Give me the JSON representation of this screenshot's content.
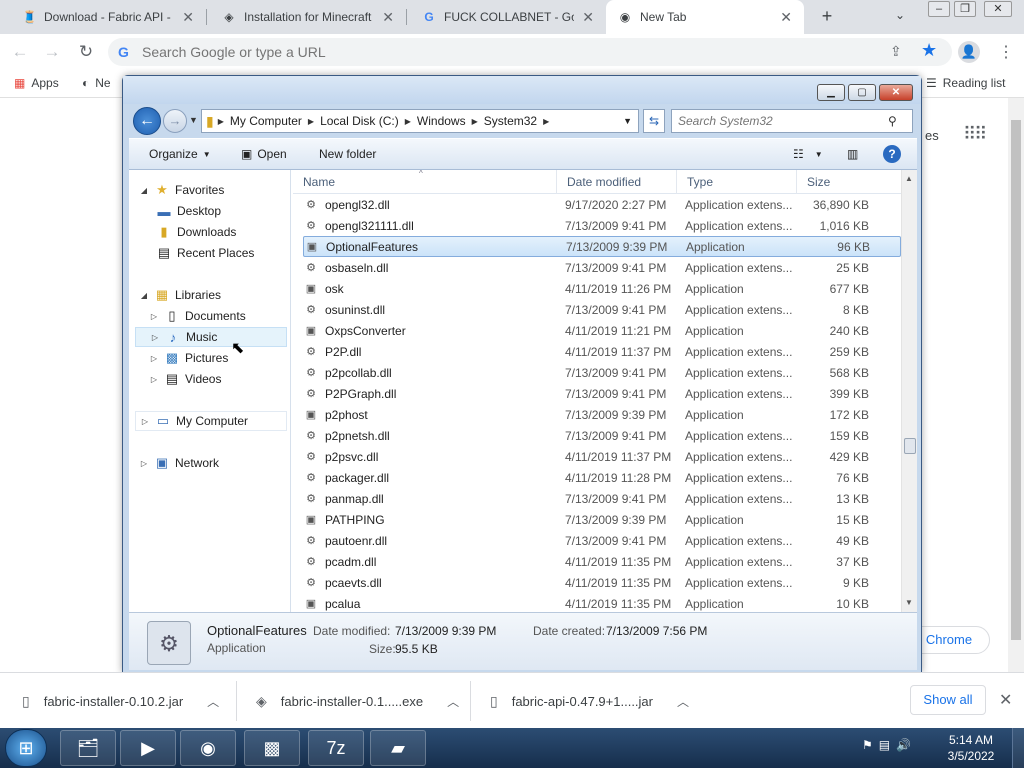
{
  "chrome": {
    "tabs": [
      {
        "title": "Download - Fabric API - M",
        "favicon": "fabric-icon",
        "active": false
      },
      {
        "title": "Installation for Minecraft",
        "favicon": "fabric-diamond-icon",
        "active": false
      },
      {
        "title": "FUCK COLLABNET - Goo",
        "favicon": "google-icon",
        "active": false
      },
      {
        "title": "New Tab",
        "favicon": "chrome-icon",
        "active": true
      }
    ],
    "new_tab_button": "+",
    "omnibox_placeholder": "Search Google or type a URL",
    "bookmarks": [
      {
        "label": "Apps",
        "icon": "apps-grid-icon"
      },
      {
        "label": "Ne",
        "icon": "globe-icon"
      }
    ],
    "reading_list": "Reading list",
    "ntp": {
      "partial_text": "es",
      "customize_label": "e Chrome"
    }
  },
  "explorer": {
    "breadcrumb": [
      "My Computer",
      "Local Disk (C:)",
      "Windows",
      "System32"
    ],
    "search_placeholder": "Search System32",
    "commands": {
      "organize": "Organize",
      "open": "Open",
      "new_folder": "New folder"
    },
    "nav": {
      "favorites": "Favorites",
      "favorites_items": [
        "Desktop",
        "Downloads",
        "Recent Places"
      ],
      "libraries": "Libraries",
      "libraries_items": [
        "Documents",
        "Music",
        "Pictures",
        "Videos"
      ],
      "my_computer": "My Computer",
      "network": "Network"
    },
    "columns": [
      "Name",
      "Date modified",
      "Type",
      "Size"
    ],
    "files": [
      [
        "opengl32.dll",
        "9/17/2020 2:27 PM",
        "Application extens...",
        "36,890 KB"
      ],
      [
        "opengl321111.dll",
        "7/13/2009 9:41 PM",
        "Application extens...",
        "1,016 KB"
      ],
      [
        "OptionalFeatures",
        "7/13/2009 9:39 PM",
        "Application",
        "96 KB"
      ],
      [
        "osbaseln.dll",
        "7/13/2009 9:41 PM",
        "Application extens...",
        "25 KB"
      ],
      [
        "osk",
        "4/11/2019 11:26 PM",
        "Application",
        "677 KB"
      ],
      [
        "osuninst.dll",
        "7/13/2009 9:41 PM",
        "Application extens...",
        "8 KB"
      ],
      [
        "OxpsConverter",
        "4/11/2019 11:21 PM",
        "Application",
        "240 KB"
      ],
      [
        "P2P.dll",
        "4/11/2019 11:37 PM",
        "Application extens...",
        "259 KB"
      ],
      [
        "p2pcollab.dll",
        "7/13/2009 9:41 PM",
        "Application extens...",
        "568 KB"
      ],
      [
        "P2PGraph.dll",
        "7/13/2009 9:41 PM",
        "Application extens...",
        "399 KB"
      ],
      [
        "p2phost",
        "7/13/2009 9:39 PM",
        "Application",
        "172 KB"
      ],
      [
        "p2pnetsh.dll",
        "7/13/2009 9:41 PM",
        "Application extens...",
        "159 KB"
      ],
      [
        "p2psvc.dll",
        "4/11/2019 11:37 PM",
        "Application extens...",
        "429 KB"
      ],
      [
        "packager.dll",
        "4/11/2019 11:28 PM",
        "Application extens...",
        "76 KB"
      ],
      [
        "panmap.dll",
        "7/13/2009 9:41 PM",
        "Application extens...",
        "13 KB"
      ],
      [
        "PATHPING",
        "7/13/2009 9:39 PM",
        "Application",
        "15 KB"
      ],
      [
        "pautoenr.dll",
        "7/13/2009 9:41 PM",
        "Application extens...",
        "49 KB"
      ],
      [
        "pcadm.dll",
        "4/11/2019 11:35 PM",
        "Application extens...",
        "37 KB"
      ],
      [
        "pcaevts.dll",
        "4/11/2019 11:35 PM",
        "Application extens...",
        "9 KB"
      ],
      [
        "pcalua",
        "4/11/2019 11:35 PM",
        "Application",
        "10 KB"
      ]
    ],
    "selected_index": 2,
    "details": {
      "name": "OptionalFeatures",
      "type": "Application",
      "date_modified_label": "Date modified:",
      "date_modified": "7/13/2009 9:39 PM",
      "date_created_label": "Date created:",
      "date_created": "7/13/2009 7:56 PM",
      "size_label": "Size:",
      "size": "95.5 KB"
    }
  },
  "downloads": [
    {
      "name": "fabric-installer-0.10.2.jar"
    },
    {
      "name": "fabric-installer-0.1.....exe"
    },
    {
      "name": "fabric-api-0.47.9+1.....jar"
    }
  ],
  "downloads_show_all": "Show all",
  "taskbar": {
    "time": "5:14 AM",
    "date": "3/5/2022"
  }
}
